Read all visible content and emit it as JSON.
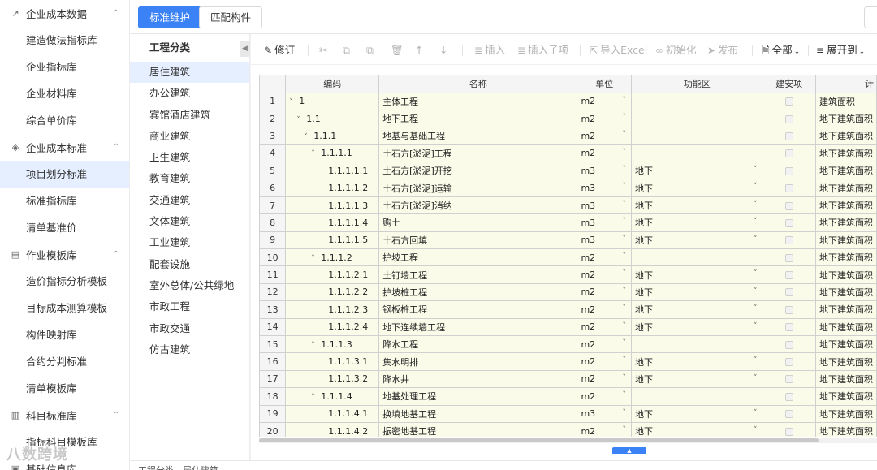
{
  "sidebar": {
    "groups": [
      {
        "label": "企业成本数据",
        "icon": "chart-icon",
        "items": [
          "建造做法指标库",
          "企业指标库",
          "企业材料库",
          "综合单价库"
        ]
      },
      {
        "label": "企业成本标准",
        "icon": "layers-icon",
        "items": [
          "项目划分标准",
          "标准指标库",
          "清单基准价"
        ]
      },
      {
        "label": "作业模板库",
        "icon": "template-icon",
        "items": [
          "造价指标分析模板",
          "目标成本测算模板",
          "构件映射库",
          "合约分判标准",
          "清单模板库"
        ]
      },
      {
        "label": "科目标准库",
        "icon": "book-icon",
        "items": [
          "指标科目模板库"
        ]
      }
    ],
    "partial_group": "基础信息库",
    "active_item": "项目划分标准",
    "watermark": "八数跨境"
  },
  "tabs": {
    "active": "标准维护",
    "other": "匹配构件"
  },
  "category": {
    "title": "工程分类",
    "items": [
      "居住建筑",
      "办公建筑",
      "宾馆酒店建筑",
      "商业建筑",
      "卫生建筑",
      "教育建筑",
      "交通建筑",
      "文体建筑",
      "工业建筑",
      "配套设施",
      "室外总体/公共绿地",
      "市政工程",
      "市政交通",
      "仿古建筑"
    ],
    "active": "居住建筑"
  },
  "toolbar": {
    "revise": "修订",
    "insert": "插入",
    "insert_child": "插入子项",
    "import_excel": "导入Excel",
    "initialize": "初始化",
    "publish": "发布",
    "all": "全部",
    "expand_to": "展开到"
  },
  "table": {
    "headers": [
      "编码",
      "名称",
      "单位",
      "功能区",
      "建安项",
      "计"
    ],
    "rows": [
      {
        "n": "1",
        "code": "1",
        "level": 0,
        "toggle": true,
        "name": "主体工程",
        "unit": "m2",
        "zone": "",
        "calc": "建筑面积"
      },
      {
        "n": "2",
        "code": "1.1",
        "level": 1,
        "toggle": true,
        "name": "地下工程",
        "unit": "m2",
        "zone": "",
        "calc": "地下建筑面积"
      },
      {
        "n": "3",
        "code": "1.1.1",
        "level": 2,
        "toggle": true,
        "name": "地基与基础工程",
        "unit": "m2",
        "zone": "",
        "calc": "地下建筑面积"
      },
      {
        "n": "4",
        "code": "1.1.1.1",
        "level": 3,
        "toggle": true,
        "name": "土石方[淤泥]工程",
        "unit": "m2",
        "zone": "",
        "calc": "地下建筑面积"
      },
      {
        "n": "5",
        "code": "1.1.1.1.1",
        "level": 4,
        "toggle": false,
        "name": "土石方[淤泥]开挖",
        "unit": "m3",
        "zone": "地下",
        "calc": "地下建筑面积"
      },
      {
        "n": "6",
        "code": "1.1.1.1.2",
        "level": 4,
        "toggle": false,
        "name": "土石方[淤泥]运输",
        "unit": "m3",
        "zone": "地下",
        "calc": "地下建筑面积"
      },
      {
        "n": "7",
        "code": "1.1.1.1.3",
        "level": 4,
        "toggle": false,
        "name": "土石方[淤泥]消纳",
        "unit": "m3",
        "zone": "地下",
        "calc": "地下建筑面积"
      },
      {
        "n": "8",
        "code": "1.1.1.1.4",
        "level": 4,
        "toggle": false,
        "name": "购土",
        "unit": "m3",
        "zone": "地下",
        "calc": "地下建筑面积"
      },
      {
        "n": "9",
        "code": "1.1.1.1.5",
        "level": 4,
        "toggle": false,
        "name": "土石方回填",
        "unit": "m3",
        "zone": "地下",
        "calc": "地下建筑面积"
      },
      {
        "n": "10",
        "code": "1.1.1.2",
        "level": 3,
        "toggle": true,
        "name": "护坡工程",
        "unit": "m2",
        "zone": "",
        "calc": "地下建筑面积"
      },
      {
        "n": "11",
        "code": "1.1.1.2.1",
        "level": 4,
        "toggle": false,
        "name": "土钉墙工程",
        "unit": "m2",
        "zone": "地下",
        "calc": "地下建筑面积"
      },
      {
        "n": "12",
        "code": "1.1.1.2.2",
        "level": 4,
        "toggle": false,
        "name": "护坡桩工程",
        "unit": "m2",
        "zone": "地下",
        "calc": "地下建筑面积"
      },
      {
        "n": "13",
        "code": "1.1.1.2.3",
        "level": 4,
        "toggle": false,
        "name": "钢板桩工程",
        "unit": "m2",
        "zone": "地下",
        "calc": "地下建筑面积"
      },
      {
        "n": "14",
        "code": "1.1.1.2.4",
        "level": 4,
        "toggle": false,
        "name": "地下连续墙工程",
        "unit": "m2",
        "zone": "地下",
        "calc": "地下建筑面积"
      },
      {
        "n": "15",
        "code": "1.1.1.3",
        "level": 3,
        "toggle": true,
        "name": "降水工程",
        "unit": "m2",
        "zone": "",
        "calc": "地下建筑面积"
      },
      {
        "n": "16",
        "code": "1.1.1.3.1",
        "level": 4,
        "toggle": false,
        "name": "集水明排",
        "unit": "m2",
        "zone": "地下",
        "calc": "地下建筑面积"
      },
      {
        "n": "17",
        "code": "1.1.1.3.2",
        "level": 4,
        "toggle": false,
        "name": "降水井",
        "unit": "m2",
        "zone": "地下",
        "calc": "地下建筑面积"
      },
      {
        "n": "18",
        "code": "1.1.1.4",
        "level": 3,
        "toggle": true,
        "name": "地基处理工程",
        "unit": "m2",
        "zone": "",
        "calc": "地下建筑面积"
      },
      {
        "n": "19",
        "code": "1.1.1.4.1",
        "level": 4,
        "toggle": false,
        "name": "换填地基工程",
        "unit": "m3",
        "zone": "地下",
        "calc": "地下建筑面积"
      },
      {
        "n": "20",
        "code": "1.1.1.4.2",
        "level": 4,
        "toggle": false,
        "name": "振密地基工程",
        "unit": "m2",
        "zone": "地下",
        "calc": "地下建筑面积"
      }
    ]
  },
  "footer": {
    "path": "工程分类 - 居住建筑"
  }
}
